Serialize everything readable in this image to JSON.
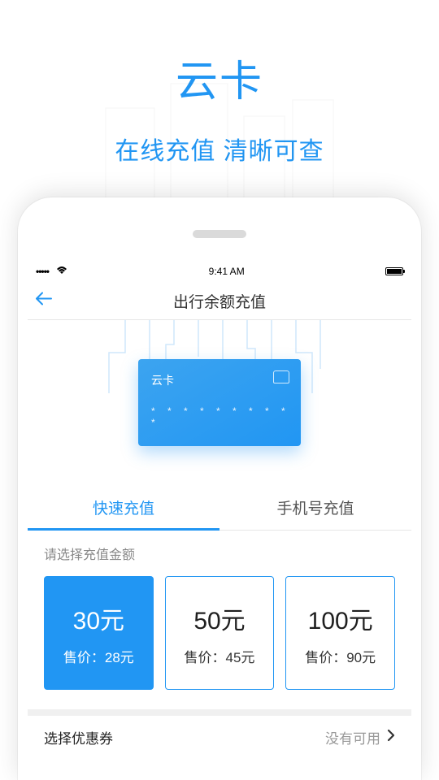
{
  "hero": {
    "title": "云卡",
    "subtitle": "在线充值 清晰可查"
  },
  "statusbar": {
    "signal": "•••••",
    "time": "9:41 AM"
  },
  "navbar": {
    "title": "出行余额充值"
  },
  "card": {
    "label": "云卡",
    "number": "* * * * * * * * * *"
  },
  "tabs": {
    "active": "快速充值",
    "inactive": "手机号充值"
  },
  "section_label": "请选择充值金额",
  "amounts": [
    {
      "value": "30元",
      "price": "售价：28元",
      "selected": true
    },
    {
      "value": "50元",
      "price": "售价：45元",
      "selected": false
    },
    {
      "value": "100元",
      "price": "售价：90元",
      "selected": false
    }
  ],
  "coupon": {
    "label": "选择优惠券",
    "status": "没有可用"
  },
  "colors": {
    "accent": "#2196f3"
  }
}
